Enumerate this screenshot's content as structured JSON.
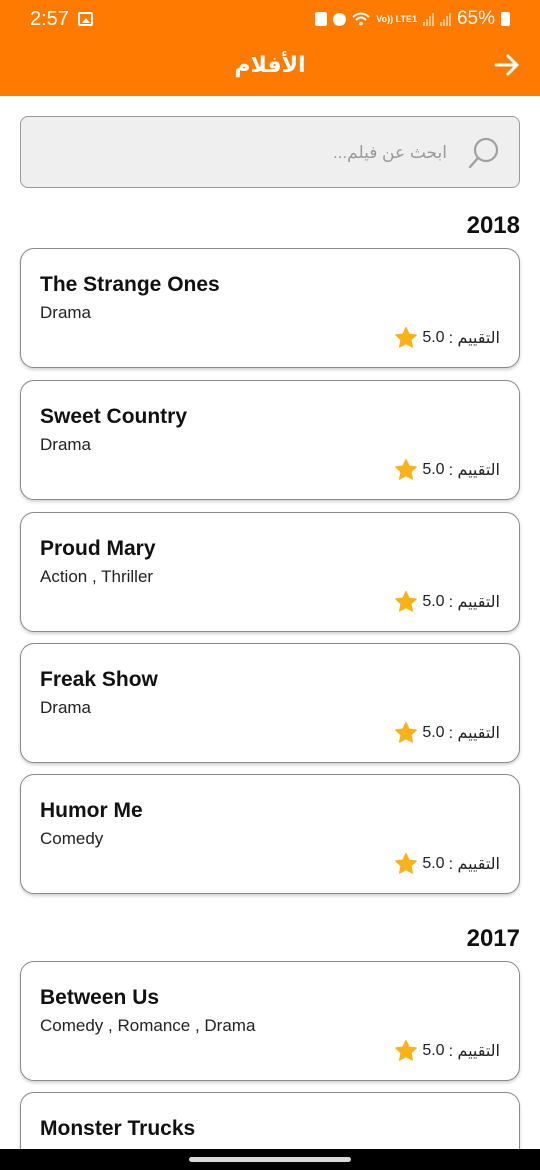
{
  "status_bar": {
    "time": "2:57",
    "network_label": "Vo)) LTE1",
    "battery": "65%"
  },
  "app_bar": {
    "title": "الأفلام",
    "back_icon": "arrow-right-icon"
  },
  "search": {
    "placeholder": "ابحث عن فيلم...",
    "icon": "search-icon"
  },
  "rating_label": "التقييم :",
  "colors": {
    "accent": "#ff7a00",
    "star": "#f9b21a",
    "search_bg": "#efefef"
  },
  "sections": [
    {
      "year": "2018",
      "movies": [
        {
          "title": "The Strange Ones",
          "genres": "Drama",
          "rating": "5.0"
        },
        {
          "title": "Sweet Country",
          "genres": "Drama",
          "rating": "5.0"
        },
        {
          "title": "Proud Mary",
          "genres": "Action , Thriller",
          "rating": "5.0"
        },
        {
          "title": "Freak Show",
          "genres": "Drama",
          "rating": "5.0"
        },
        {
          "title": "Humor Me",
          "genres": "Comedy",
          "rating": "5.0"
        }
      ]
    },
    {
      "year": "2017",
      "movies": [
        {
          "title": "Between Us",
          "genres": "Comedy , Romance , Drama",
          "rating": "5.0"
        },
        {
          "title": "Monster Trucks",
          "genres": "",
          "rating": ""
        }
      ]
    }
  ]
}
